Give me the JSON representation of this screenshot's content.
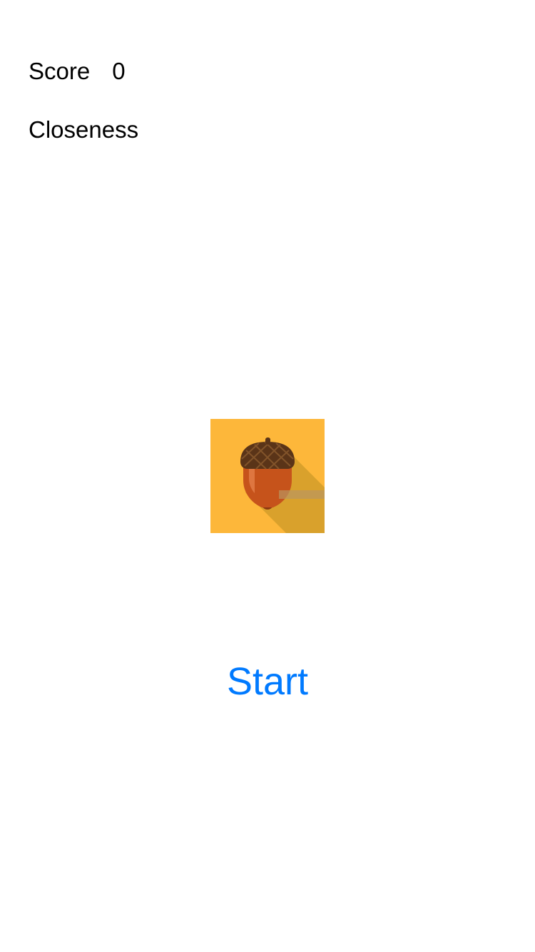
{
  "score": {
    "label": "Score",
    "value": "0"
  },
  "closeness": {
    "label": "Closeness"
  },
  "acorn_image": {
    "icon": "acorn-icon",
    "background_color": "#FDB73A",
    "shadow_color": "#D9A12C",
    "cap_color": "#5A3418",
    "body_color": "#C6531B"
  },
  "start_button": {
    "label": "Start",
    "color": "#007AFF"
  }
}
